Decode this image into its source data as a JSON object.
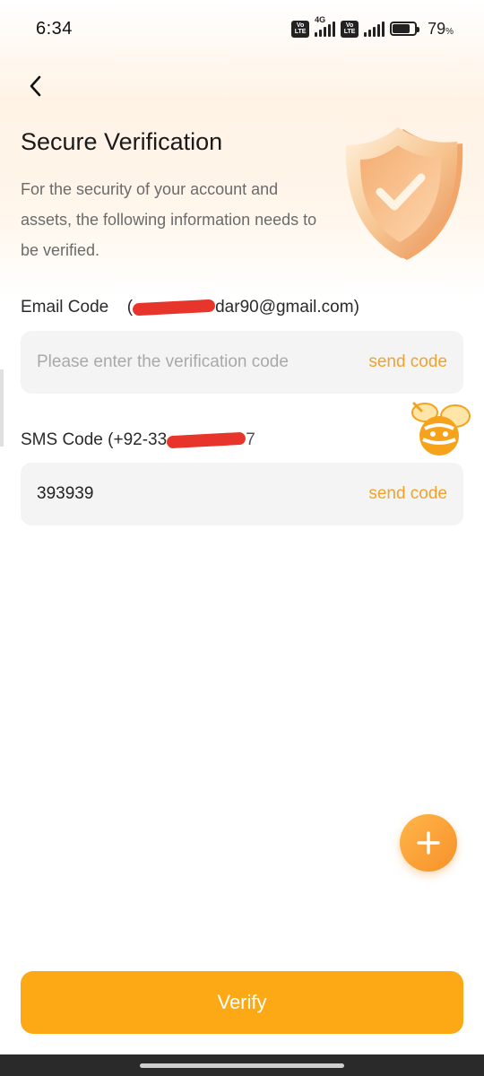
{
  "status_bar": {
    "time": "6:34",
    "network_type": "4G",
    "volte_label_top": "Vo",
    "volte_label_bottom": "LTE",
    "battery_percent": "79",
    "battery_unit": "%",
    "battery_level": 0.79
  },
  "header": {
    "title": "Secure Verification",
    "subtitle": "For the security of your account and assets, the following information needs to be verified."
  },
  "email": {
    "label": "Email Code",
    "open_paren": "(",
    "value_visible": "dar90@gmail.com)",
    "placeholder": "Please enter the verification code",
    "value": "",
    "send_label": "send code"
  },
  "sms": {
    "label": "SMS Code",
    "value_visible": "(+92-33",
    "value_tail": "7",
    "value": "393939",
    "send_label": "send code"
  },
  "actions": {
    "verify_label": "Verify",
    "fab_icon": "plus-icon"
  },
  "colors": {
    "accent": "#fda915",
    "link": "#f0a22c",
    "redaction": "#e8352b"
  }
}
